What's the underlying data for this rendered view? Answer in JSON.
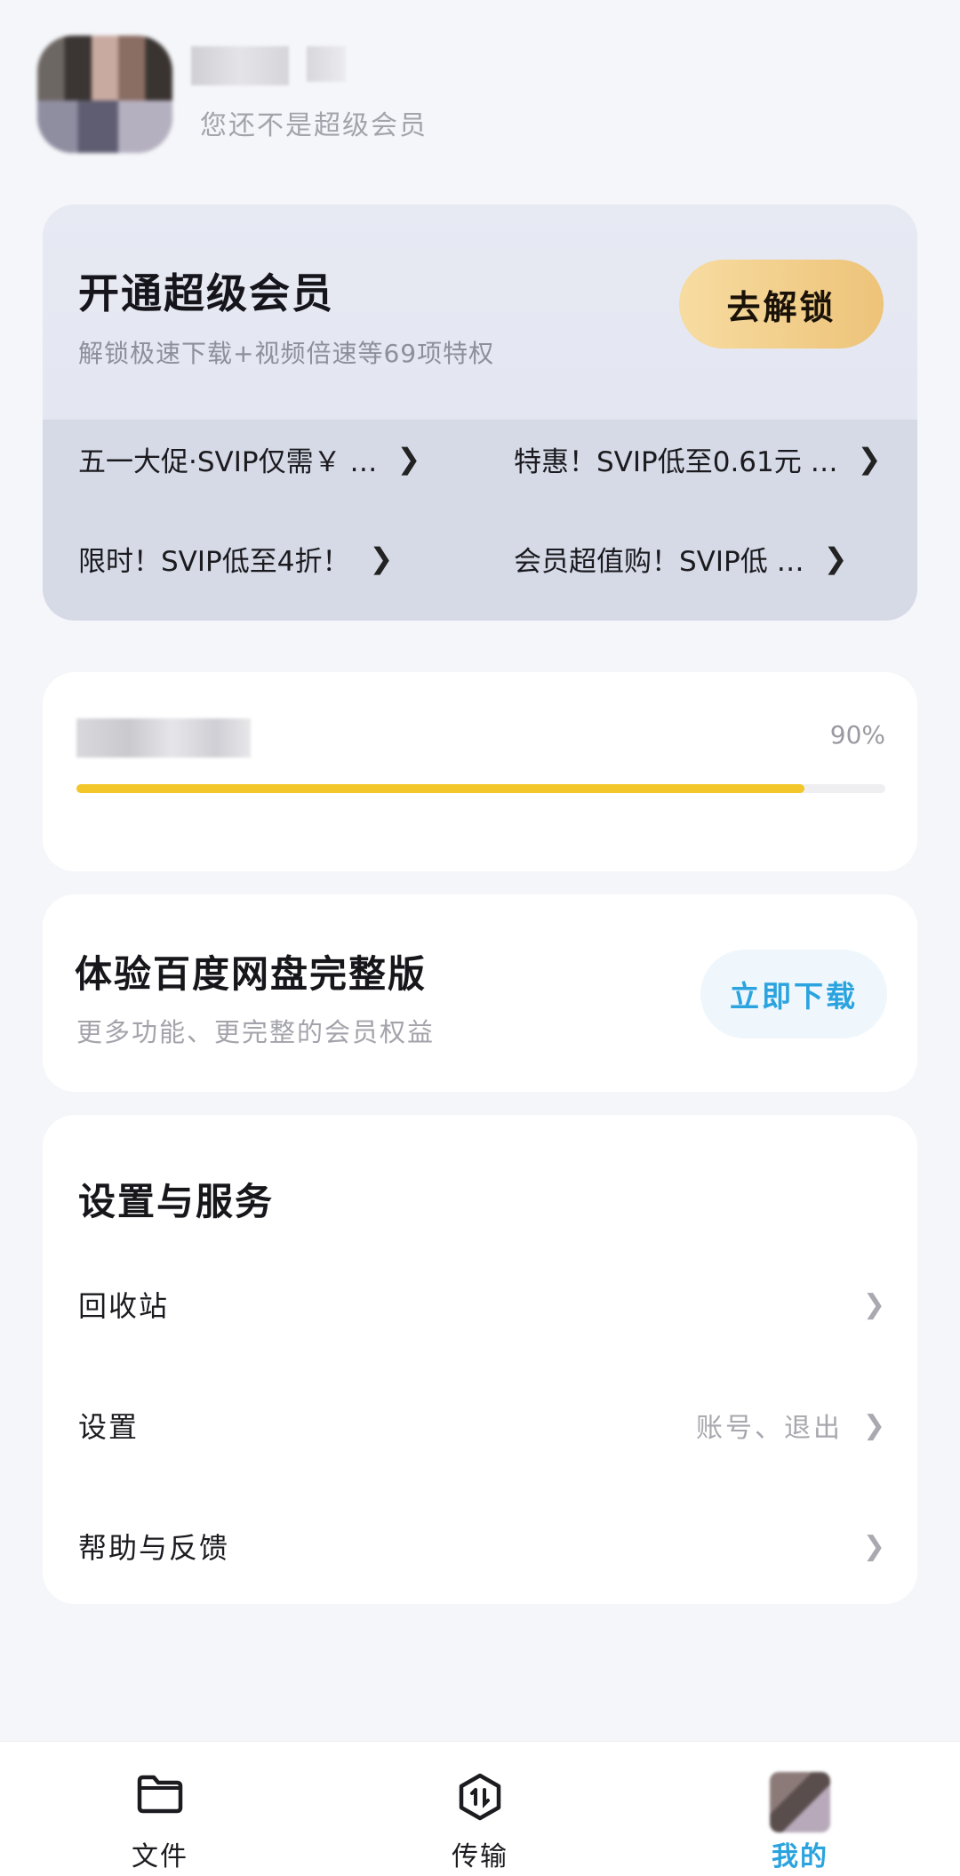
{
  "profile": {
    "member_status": "您还不是超级会员"
  },
  "vip": {
    "title": "开通超级会员",
    "subtitle": "解锁极速下载+视频倍速等69项特权",
    "button": "去解锁",
    "promos": [
      {
        "text": "五一大促·SVIP仅需￥ …"
      },
      {
        "text": "特惠！SVIP低至0.61元 …"
      },
      {
        "text": "限时！SVIP低至4折！"
      },
      {
        "text": "会员超值购！SVIP低 …"
      }
    ]
  },
  "storage": {
    "percent_label": "90%",
    "percent_value": 0.9
  },
  "download": {
    "title": "体验百度网盘完整版",
    "subtitle": "更多功能、更完整的会员权益",
    "button": "立即下载"
  },
  "settings": {
    "title": "设置与服务",
    "items": [
      {
        "label": "回收站",
        "hint": ""
      },
      {
        "label": "设置",
        "hint": "账号、退出"
      },
      {
        "label": "帮助与反馈",
        "hint": ""
      }
    ]
  },
  "tabbar": {
    "tabs": [
      {
        "label": "文件",
        "icon": "folder-icon"
      },
      {
        "label": "传输",
        "icon": "transfer-icon"
      },
      {
        "label": "我的",
        "icon": "avatar"
      }
    ],
    "active_tab": "我的",
    "active_color": "#2aa3df"
  },
  "colors": {
    "progress_fill": "#f3c629",
    "unlock_gradient_start": "#f7dca1",
    "unlock_gradient_end": "#edc379"
  }
}
